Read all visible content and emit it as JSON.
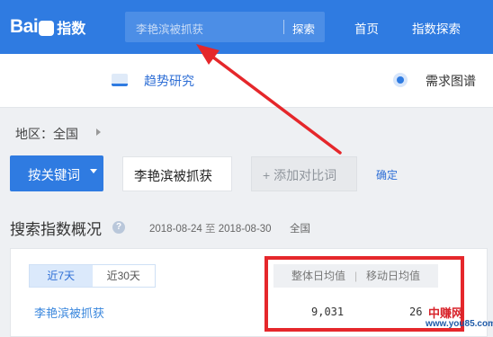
{
  "header": {
    "logo_text": "Bai",
    "logo_suffix": "指数",
    "search_query": "李艳滨被抓获",
    "search_button": "探索",
    "nav": [
      "首页",
      "指数探索"
    ]
  },
  "subnav": {
    "trend_label": "趋势研究",
    "map_label": "需求图谱"
  },
  "filters": {
    "region_label": "地区：全国",
    "keyword_button": "按关键词",
    "keyword_value": "李艳滨被抓获",
    "add_compare": "+ 添加对比词",
    "confirm": "确定"
  },
  "overview": {
    "title": "搜索指数概况",
    "help": "?",
    "date_start": "2018-08-24",
    "date_to": "至",
    "date_end": "2018-08-30",
    "scope": "全国",
    "tabs": [
      "近7天",
      "近30天"
    ],
    "keyword": "李艳滨被抓获",
    "col_overall": "整体日均值",
    "col_sep": "|",
    "col_mobile": "移动日均值",
    "overall_value": "9,031",
    "mobile_value": "26"
  },
  "watermark": {
    "line1": "中赚网",
    "line2": "www.you85.com"
  },
  "colors": {
    "brand_blue": "#2f7be1",
    "annotation_red": "#e5272b"
  }
}
